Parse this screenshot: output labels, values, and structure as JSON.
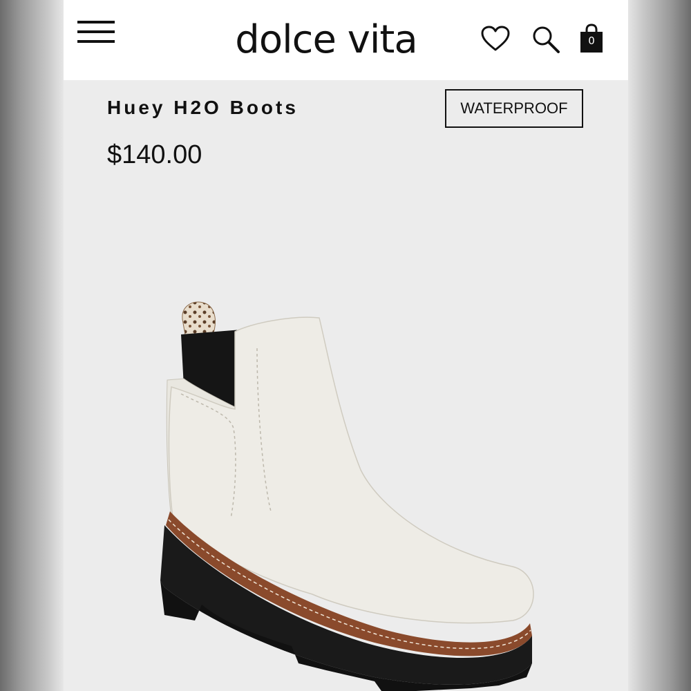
{
  "header": {
    "logo": "dolce vita",
    "cart_count": "0",
    "icons": [
      "menu-icon",
      "heart-icon",
      "search-icon",
      "shopping-bag-icon"
    ]
  },
  "product": {
    "name": "Huey H2O Boots",
    "badge": "WATERPROOF",
    "price": "$140.00",
    "image": "white-leather-chelsea-boot-photo"
  },
  "colors": {
    "header_bg": "#ffffff",
    "page_bg": "#ececec",
    "text": "#111111"
  }
}
